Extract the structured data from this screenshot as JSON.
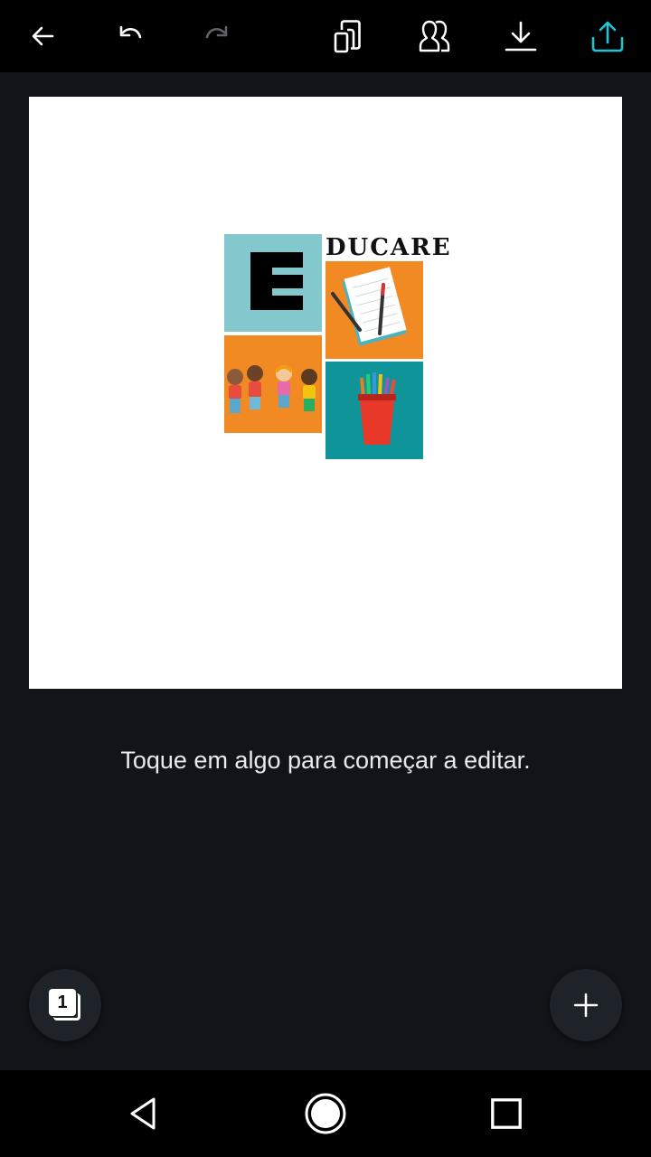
{
  "toolbar": {
    "icons": {
      "back": "arrow-left-icon",
      "undo": "undo-icon",
      "redo": "redo-icon",
      "copy": "duplicate-icon",
      "share_people": "collaborate-icon",
      "download": "download-icon",
      "upload": "share-upload-icon"
    },
    "accent_color": "#1ec5d8",
    "disabled_color": "#5f6368"
  },
  "canvas": {
    "logo": {
      "letter": "E",
      "text": "DUCARE",
      "tile_colors": {
        "top_left": "#82c8cc",
        "top_right": "#f28a23",
        "bottom_left": "#f28a23",
        "bottom_right": "#0e9499"
      }
    }
  },
  "hint_text": "Toque em algo para começar a editar.",
  "pages_button": {
    "count": "1"
  },
  "add_button": {
    "icon": "plus-icon"
  },
  "navbar": {
    "back": "nav-back-icon",
    "home": "nav-home-icon",
    "recents": "nav-recents-icon"
  }
}
